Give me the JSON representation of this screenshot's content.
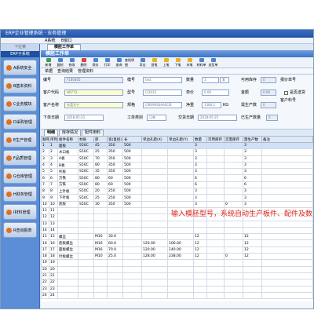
{
  "window": {
    "title": "ERP企业管理系统 · 业务管理"
  },
  "menu": [
    "A系统",
    "B窗口"
  ],
  "sidebar": {
    "header": "下拉菜",
    "subheader": "ERP子系统",
    "items": [
      {
        "label": "A系统安全",
        "icon": "shield-icon"
      },
      {
        "label": "B基本资料",
        "icon": "data-icon"
      },
      {
        "label": "C业务模块",
        "icon": "module-icon"
      },
      {
        "label": "D采购管理",
        "icon": "purchase-icon"
      },
      {
        "label": "E生产管理",
        "icon": "factory-icon"
      },
      {
        "label": "F品质管理",
        "icon": "quality-icon"
      },
      {
        "label": "G仓库管理",
        "icon": "warehouse-icon"
      },
      {
        "label": "H财务管理",
        "icon": "finance-icon"
      },
      {
        "label": "I材料管理",
        "icon": "material-icon"
      },
      {
        "label": "R查询报表",
        "icon": "report-icon"
      }
    ]
  },
  "main_tab": "模胚工作单",
  "form_title": "模胚工作单",
  "toolbar": [
    {
      "label": "新增",
      "icon": "new-icon",
      "color": "green"
    },
    {
      "label": "复制",
      "icon": "copy-icon",
      "color": "blue"
    },
    {
      "label": "修改",
      "icon": "edit-icon",
      "color": "blue"
    },
    {
      "label": "删除",
      "icon": "delete-icon",
      "color": "red"
    },
    {
      "label": "保存",
      "icon": "save-icon",
      "color": "blue"
    },
    {
      "label": "打印",
      "icon": "print-icon",
      "color": "blue"
    },
    {
      "label": "查询",
      "icon": "search-icon",
      "color": "blue"
    },
    {
      "label": "查找明细",
      "icon": "find-icon",
      "color": "blue"
    },
    {
      "label": "导出",
      "icon": "export-icon",
      "color": "blue"
    },
    {
      "label": "首笔",
      "icon": "first-icon",
      "color": "yellow"
    },
    {
      "label": "上笔",
      "icon": "prev-icon",
      "color": "yellow"
    },
    {
      "label": "下笔",
      "icon": "next-icon",
      "color": "yellow"
    },
    {
      "label": "末笔",
      "icon": "last-icon",
      "color": "yellow"
    },
    {
      "label": "材料单",
      "icon": "material-list-icon",
      "color": "blue"
    },
    {
      "label": "送货单",
      "icon": "delivery-icon",
      "color": "blue"
    }
  ],
  "subtabs": [
    "单据",
    "查询结果",
    "管理资料"
  ],
  "form": {
    "labels": {
      "no": "编号",
      "model": "模号",
      "qty": "数量",
      "stock_qty": "可用库存",
      "quote_no": "报价单号",
      "customer_code": "客户代码",
      "type": "型号",
      "unit_price": "单价",
      "amount": "金额",
      "approve": "客户料号",
      "customer_name": "客户名称",
      "spec": "规格",
      "weight": "净重",
      "need_prod": "需生产数",
      "order_date": "下单日期",
      "work_type": "工单类别",
      "delivery_date": "交货日期",
      "produced": "已生产数量"
    },
    "values": {
      "no": "F180405",
      "model": "test",
      "qty": "3",
      "qty_unit": "套",
      "customer_code": "H0773",
      "type": "CI2025",
      "unit_price": "0.00",
      "amount": "0.00",
      "customer_name": "东莞天宁",
      "spec": "CI8090S04A0CI6",
      "weight": "1384.2",
      "weight_unit": "KG",
      "order_date": "2018-05-21",
      "work_type": "订单",
      "delivery_date": "2018-05-25",
      "stock_qty": "0",
      "need_prod": "0",
      "produced": "0"
    },
    "checkbox_label": "是否送货"
  },
  "detail_tabs": [
    "明细",
    "库存情况",
    "配件用料"
  ],
  "table": {
    "columns": [
      "顺序",
      "序列号",
      "板件名称",
      "材质",
      "厚",
      "宽(直径)",
      "长",
      "单边孔距(X)",
      "单边孔距(Y)",
      "数量",
      "可用库存",
      "实需库存",
      "需生产数",
      "备注"
    ],
    "rows": [
      [
        "1",
        "1",
        "面板",
        "S50C",
        "45",
        "350",
        "500",
        "",
        "",
        "3",
        "",
        "",
        "3",
        ""
      ],
      [
        "2",
        "2",
        "水口板",
        "S50C",
        "25",
        "350",
        "500",
        "",
        "",
        "3",
        "",
        "",
        "3",
        ""
      ],
      [
        "3",
        "3",
        "A板",
        "S50C",
        "70",
        "350",
        "500",
        "",
        "",
        "3",
        "",
        "",
        "3",
        ""
      ],
      [
        "4",
        "4",
        "B板",
        "S50C",
        "80",
        "350",
        "500",
        "",
        "",
        "3",
        "",
        "",
        "3",
        ""
      ],
      [
        "5",
        "5",
        "托板",
        "S50C",
        "35",
        "350",
        "500",
        "",
        "",
        "3",
        "",
        "",
        "3",
        ""
      ],
      [
        "6",
        "6",
        "方铁",
        "S50C",
        "80",
        "60",
        "500",
        "",
        "",
        "6",
        "",
        "",
        "6",
        ""
      ],
      [
        "7",
        "7",
        "方铁",
        "S50C",
        "80",
        "60",
        "500",
        "",
        "",
        "6",
        "",
        "",
        "6",
        ""
      ],
      [
        "8",
        "8",
        "上针板",
        "S50C",
        "20",
        "250",
        "500",
        "",
        "",
        "3",
        "",
        "",
        "3",
        ""
      ],
      [
        "9",
        "9",
        "下针板",
        "S50C",
        "25",
        "250",
        "500",
        "",
        "",
        "3",
        "",
        "",
        "3",
        ""
      ],
      [
        "10",
        "10",
        "底板",
        "S50C",
        "30",
        "350",
        "500",
        "",
        "",
        "3",
        "",
        "0",
        "3",
        ""
      ],
      [
        "11",
        "11",
        "",
        "",
        "",
        "",
        "",
        "",
        "",
        "",
        "",
        "",
        "",
        ""
      ],
      [
        "12",
        "12",
        "",
        "",
        "",
        "",
        "",
        "",
        "",
        "",
        "",
        "",
        "",
        ""
      ],
      [
        "13",
        "13",
        "",
        "",
        "",
        "",
        "",
        "",
        "",
        "",
        "",
        "",
        "",
        ""
      ],
      [
        "14",
        "14",
        "",
        "",
        "",
        "",
        "",
        "",
        "",
        "",
        "",
        "",
        "",
        ""
      ],
      [
        "15",
        "15",
        "螺丝",
        "",
        "M16",
        "30.0",
        "",
        "",
        "",
        "12",
        "",
        "",
        "12",
        ""
      ],
      [
        "16",
        "16",
        "底板螺丝",
        "",
        "M16",
        "60.0",
        "",
        "120.00",
        "100.00",
        "12",
        "",
        "",
        "12",
        ""
      ],
      [
        "17",
        "17",
        "面板螺丝",
        "",
        "M16",
        "70.0",
        "",
        "120.00",
        "140.00",
        "12",
        "",
        "",
        "12",
        ""
      ],
      [
        "18",
        "18",
        "针板螺丝",
        "",
        "M10",
        "25.0",
        "",
        "128.00",
        "238.00",
        "12",
        "",
        "0",
        "12",
        ""
      ],
      [
        "19",
        "19",
        "",
        "",
        "",
        "",
        "",
        "",
        "",
        "",
        "",
        "",
        "",
        ""
      ],
      [
        "20",
        "20",
        "",
        "",
        "",
        "",
        "",
        "",
        "",
        "",
        "",
        "",
        "",
        ""
      ],
      [
        "21",
        "21",
        "",
        "",
        "",
        "",
        "",
        "",
        "",
        "",
        "",
        "",
        "",
        ""
      ],
      [
        "22",
        "22",
        "",
        "",
        "",
        "",
        "",
        "",
        "",
        "",
        "",
        "",
        "",
        ""
      ],
      [
        "23",
        "23",
        "",
        "",
        "",
        "",
        "",
        "",
        "",
        "",
        "",
        "",
        "",
        ""
      ],
      [
        "24",
        "24",
        "",
        "",
        "",
        "",
        "",
        "",
        "",
        "",
        "",
        "",
        "",
        ""
      ]
    ]
  },
  "annotation": "输入模胚型号，系统自动生产板件、配件及数",
  "colors": {
    "accent": "#3f73c4",
    "annotation": "#e0261c",
    "highlight_field": "#fffbd0"
  }
}
